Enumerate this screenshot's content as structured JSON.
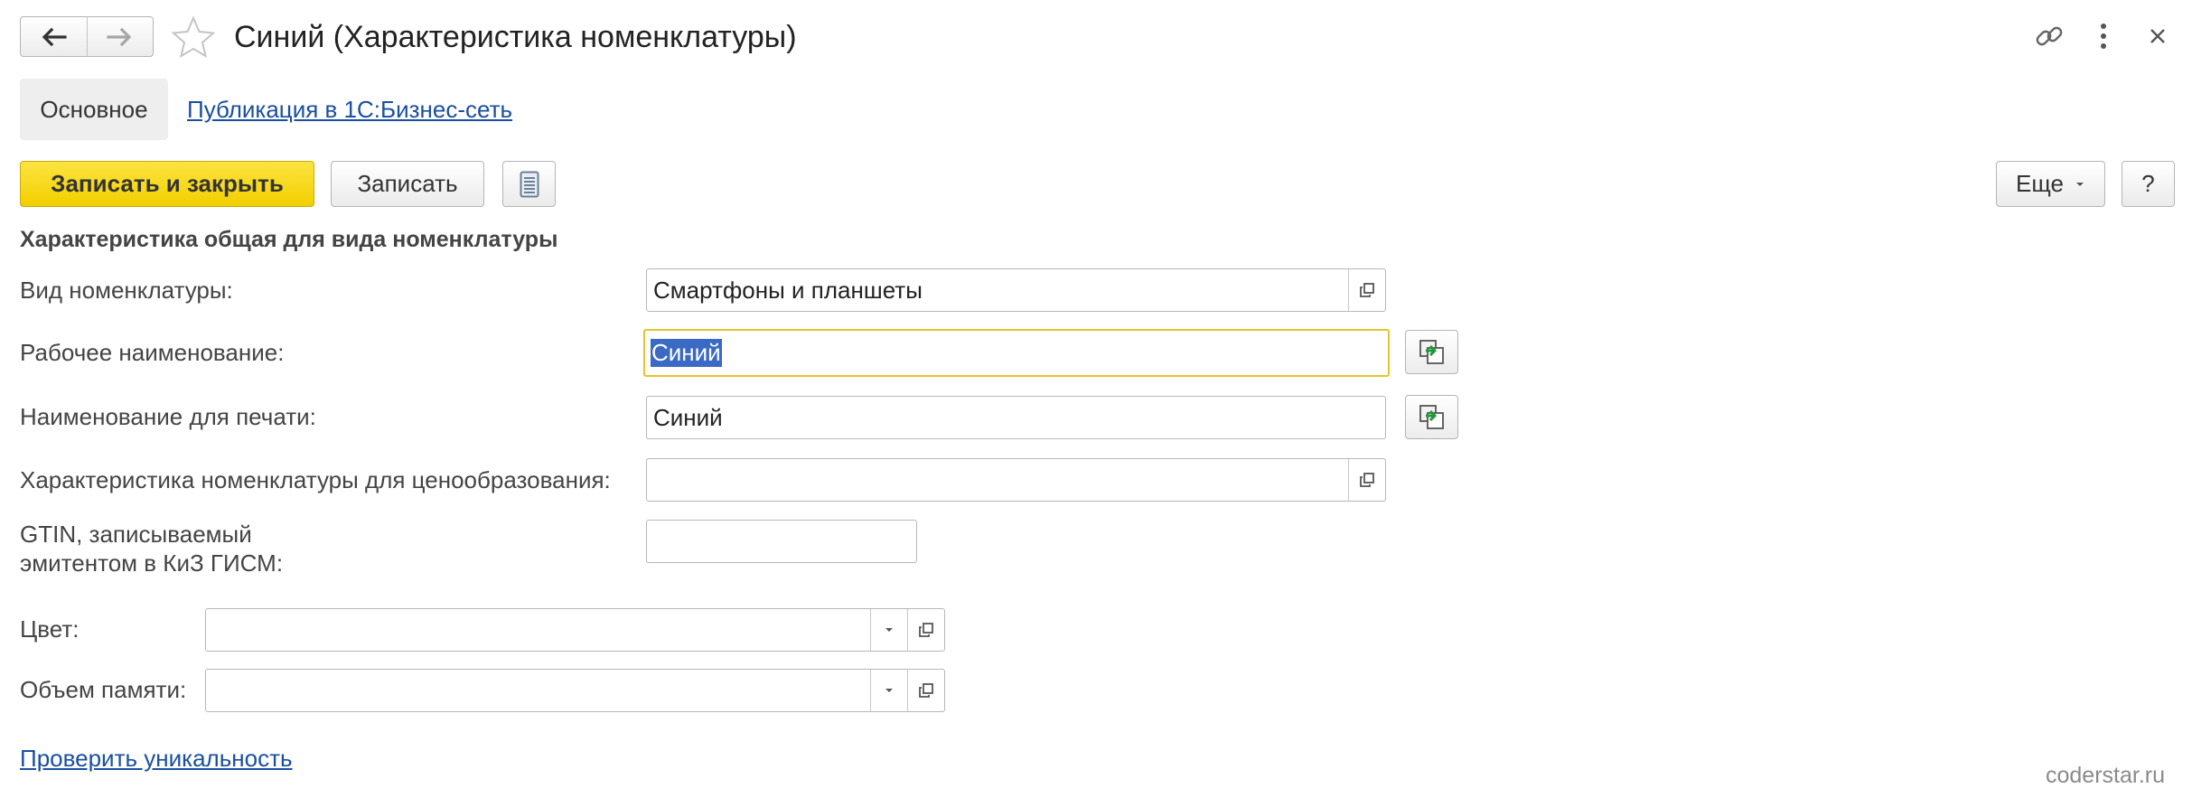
{
  "header": {
    "title": "Синий (Характеристика номенклатуры)"
  },
  "tabs": {
    "main": "Основное",
    "publication": "Публикация в 1С:Бизнес-сеть"
  },
  "toolbar": {
    "save_close_label": "Записать и закрыть",
    "save_label": "Записать",
    "more_label": "Еще",
    "help_label": "?"
  },
  "form": {
    "section_title": "Характеристика общая для вида номенклатуры",
    "kind": {
      "label": "Вид номенклатуры:",
      "value": "Смартфоны и планшеты"
    },
    "work_name": {
      "label": "Рабочее наименование:",
      "value": "Синий"
    },
    "print_name": {
      "label": "Наименование для печати:",
      "value": "Синий"
    },
    "pricing_char": {
      "label": "Характеристика номенклатуры для ценообразования:",
      "value": ""
    },
    "gtin": {
      "label_line1": "GTIN, записываемый",
      "label_line2": "эмитентом в КиЗ ГИСМ:",
      "value": ""
    },
    "color": {
      "label": "Цвет:",
      "value": ""
    },
    "memory": {
      "label": "Объем памяти:",
      "value": ""
    },
    "check_uniqueness": "Проверить уникальность"
  },
  "watermark": "coderstar.ru",
  "colors": {
    "primary_button": "#f2cf00",
    "link": "#1a4fa0",
    "focus_border": "#e7c42b",
    "selection": "#3b6ac4"
  }
}
